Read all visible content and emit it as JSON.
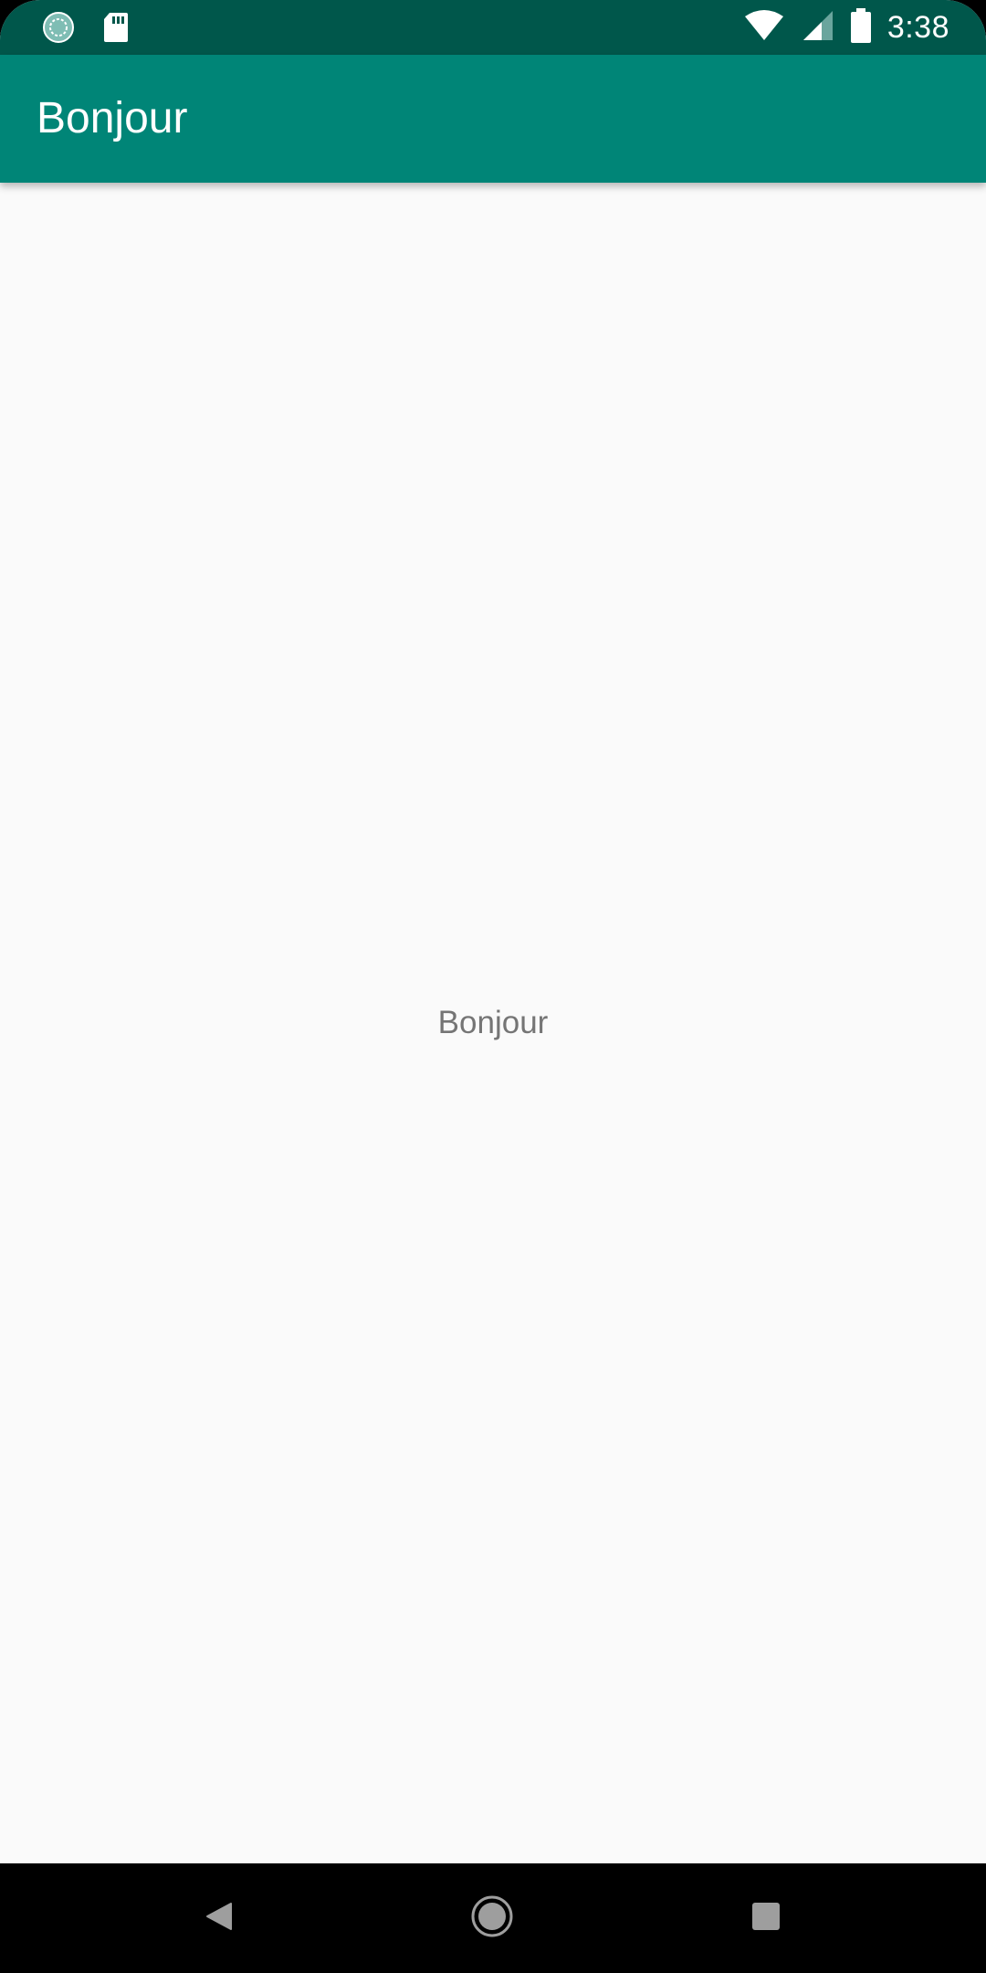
{
  "status_bar": {
    "time": "3:38",
    "icons": [
      "sync-icon",
      "sd-card-icon",
      "wifi-icon",
      "cell-signal-icon",
      "battery-icon"
    ]
  },
  "app_bar": {
    "title": "Bonjour"
  },
  "main": {
    "greeting": "Bonjour"
  },
  "nav_bar": {
    "buttons": [
      "back-icon",
      "home-icon",
      "recents-icon"
    ]
  },
  "colors": {
    "status_bar": "#00574b",
    "app_bar": "#008577",
    "background": "#fafafa",
    "text_secondary": "#757575"
  }
}
